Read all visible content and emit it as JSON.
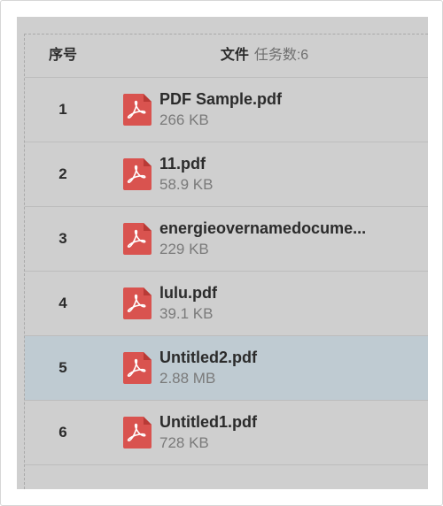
{
  "header": {
    "index_label": "序号",
    "file_label": "文件",
    "task_count_prefix": "任务数:",
    "task_count": "6"
  },
  "files": [
    {
      "index": "1",
      "name": "PDF Sample.pdf",
      "size": "266 KB",
      "icon": "pdf-file-icon"
    },
    {
      "index": "2",
      "name": "11.pdf",
      "size": "58.9 KB",
      "icon": "pdf-file-icon"
    },
    {
      "index": "3",
      "name": "energieovernamedocume...",
      "size": "229 KB",
      "icon": "pdf-file-icon"
    },
    {
      "index": "4",
      "name": "lulu.pdf",
      "size": "39.1 KB",
      "icon": "pdf-file-icon"
    },
    {
      "index": "5",
      "name": "Untitled2.pdf",
      "size": "2.88 MB",
      "icon": "pdf-file-icon",
      "selected": true
    },
    {
      "index": "6",
      "name": "Untitled1.pdf",
      "size": "728 KB",
      "icon": "pdf-file-icon"
    }
  ],
  "colors": {
    "panel_bg": "#cfcfcf",
    "selected_row_bg": "#bfcbd2",
    "pdf_icon_red": "#d9534f"
  }
}
